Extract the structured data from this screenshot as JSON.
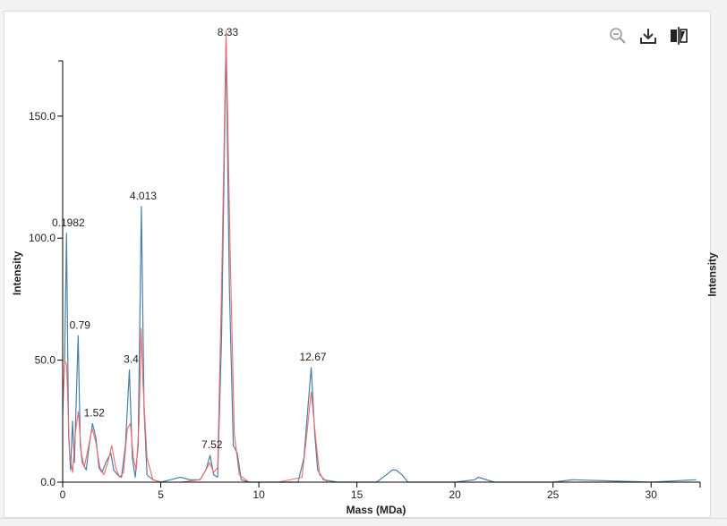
{
  "toolbar": {
    "zoom_reset_icon": "zoom-out-icon",
    "download_icon": "download-icon",
    "compare_icon": "split-view-icon"
  },
  "colors": {
    "series_blue": "#4a7fa6",
    "series_red": "#ef6b6b",
    "axis": "#000000"
  },
  "side_label": "Intensity",
  "chart_data": {
    "type": "line",
    "xlabel": "Mass (MDa)",
    "ylabel": "Intensity",
    "xlim": [
      0,
      32.5
    ],
    "ylim": [
      0,
      180
    ],
    "x_ticks": [
      0,
      5,
      10,
      15,
      20,
      25,
      30
    ],
    "x_tick_labels": [
      "0",
      "5",
      "10",
      "15",
      "20",
      "25",
      "30"
    ],
    "y_ticks": [
      0,
      50,
      100,
      150
    ],
    "y_tick_labels": [
      "0.0",
      "50.0",
      "100.0",
      "150.0"
    ],
    "grid": false,
    "series": [
      {
        "color": "#4a7fa6",
        "x": [
          0,
          0.1,
          0.1982,
          0.3,
          0.4,
          0.5,
          0.6,
          0.79,
          0.9,
          1.0,
          1.2,
          1.35,
          1.52,
          1.7,
          1.85,
          2.0,
          2.2,
          2.45,
          2.6,
          2.8,
          3.0,
          3.2,
          3.4,
          3.55,
          3.7,
          3.85,
          4.013,
          4.15,
          4.3,
          4.6,
          5.0,
          5.5,
          6.0,
          6.5,
          7.0,
          7.3,
          7.52,
          7.7,
          7.9,
          8.1,
          8.33,
          8.5,
          8.7,
          8.9,
          9.1,
          9.5,
          10.0,
          11.0,
          12.0,
          12.3,
          12.5,
          12.67,
          12.85,
          13.0,
          13.3,
          14.0,
          15.0,
          16.0,
          16.5,
          16.8,
          17.0,
          17.3,
          17.6,
          18.5,
          20.0,
          21.0,
          21.2,
          22.0,
          25.0,
          26.0,
          30.0,
          32.3
        ],
        "y": [
          28,
          50,
          102,
          20,
          5,
          25,
          8,
          60,
          15,
          8,
          5,
          15,
          24,
          18,
          6,
          4,
          8,
          12,
          5,
          3,
          2,
          15,
          46,
          10,
          2,
          15,
          113,
          30,
          3,
          1,
          0,
          1,
          2,
          1,
          1,
          5,
          11,
          3,
          2,
          60,
          180,
          80,
          15,
          12,
          1,
          0,
          0,
          0,
          0,
          10,
          30,
          47,
          20,
          5,
          1,
          0,
          0,
          0,
          3,
          5,
          5,
          3,
          0,
          0,
          0,
          1,
          2,
          0,
          0,
          1,
          0,
          1
        ]
      },
      {
        "color": "#ef6b6b",
        "x": [
          0,
          0.1,
          0.2,
          0.35,
          0.5,
          0.65,
          0.8,
          0.95,
          1.1,
          1.3,
          1.5,
          1.7,
          1.9,
          2.1,
          2.3,
          2.5,
          2.7,
          2.9,
          3.1,
          3.3,
          3.45,
          3.6,
          3.75,
          3.9,
          4.0,
          4.1,
          4.3,
          4.6,
          5.0,
          6.0,
          7.0,
          7.3,
          7.5,
          7.7,
          7.9,
          8.1,
          8.33,
          8.55,
          8.75,
          9.0,
          9.5,
          11.0,
          12.2,
          12.45,
          12.67,
          12.9,
          13.1,
          13.5,
          15.0,
          32.3
        ],
        "y": [
          30,
          50,
          48,
          12,
          4,
          20,
          29,
          12,
          6,
          14,
          22,
          16,
          6,
          3,
          8,
          15,
          6,
          2,
          4,
          22,
          24,
          10,
          5,
          25,
          63,
          40,
          10,
          1,
          0,
          0,
          1,
          5,
          8,
          4,
          6,
          80,
          185,
          90,
          20,
          3,
          0,
          0,
          2,
          20,
          37,
          18,
          3,
          0,
          0,
          0
        ]
      }
    ],
    "peak_labels": [
      {
        "x": 0.1982,
        "y": 102,
        "text": "0.1982"
      },
      {
        "x": 0.79,
        "y": 60,
        "text": "0.79"
      },
      {
        "x": 1.52,
        "y": 24,
        "text": "1.52"
      },
      {
        "x": 3.4,
        "y": 46,
        "text": "3.4"
      },
      {
        "x": 4.013,
        "y": 113,
        "text": "4.013"
      },
      {
        "x": 7.52,
        "y": 11,
        "text": "7.52"
      },
      {
        "x": 8.33,
        "y": 180,
        "text": "8.33"
      },
      {
        "x": 12.67,
        "y": 47,
        "text": "12.67"
      }
    ]
  }
}
